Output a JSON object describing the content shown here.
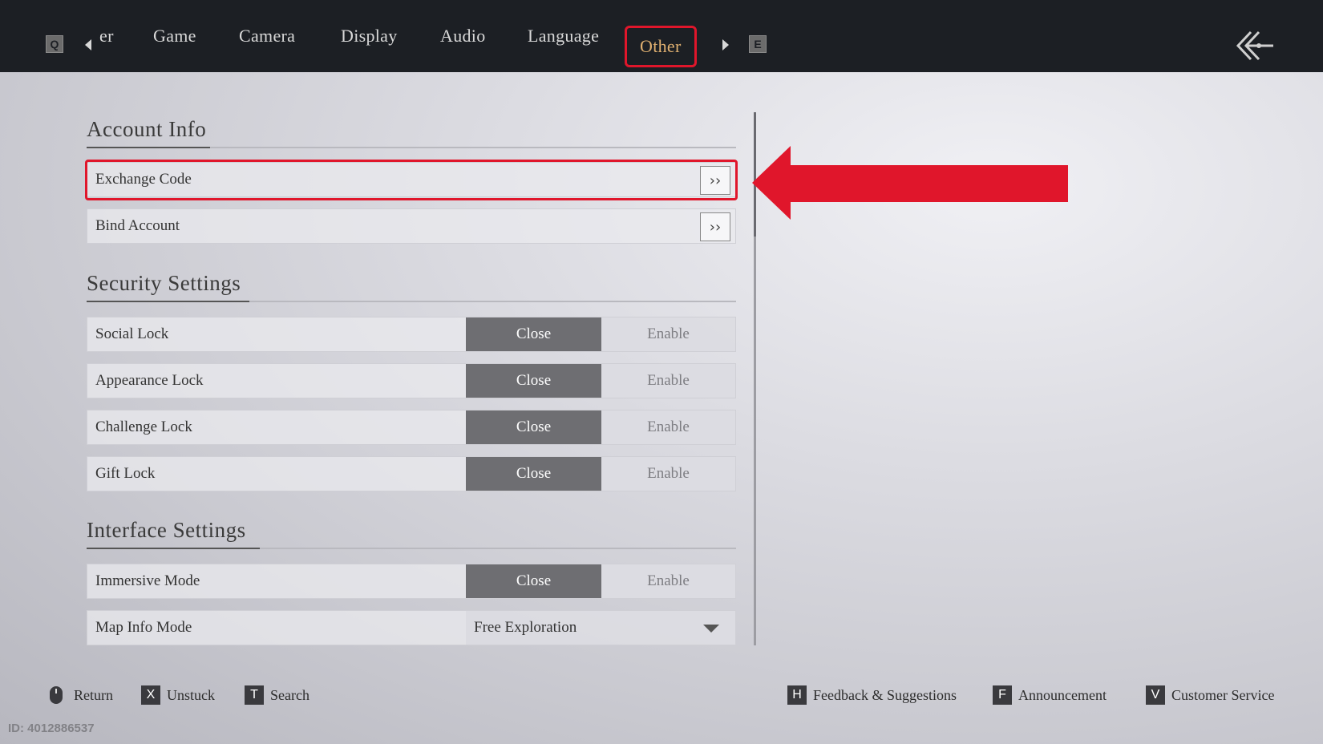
{
  "tabs": {
    "prev_key": "Q",
    "next_key": "E",
    "truncated_label": "er",
    "items": [
      "Game",
      "Camera",
      "Display",
      "Audio",
      "Language",
      "Other"
    ],
    "active": "Other"
  },
  "sections": {
    "account": {
      "title": "Account Info",
      "rows": [
        "Exchange Code",
        "Bind Account"
      ]
    },
    "security": {
      "title": "Security Settings",
      "rows": [
        "Social Lock",
        "Appearance Lock",
        "Challenge Lock",
        "Gift Lock"
      ]
    },
    "interface": {
      "title": "Interface Settings",
      "immersive": "Immersive Mode",
      "map_info": "Map Info Mode",
      "map_info_value": "Free Exploration"
    }
  },
  "toggle": {
    "close": "Close",
    "enable": "Enable",
    "selected": "Close"
  },
  "footer": {
    "return": {
      "key": "",
      "label": "Return"
    },
    "unstuck": {
      "key": "X",
      "label": "Unstuck"
    },
    "search": {
      "key": "T",
      "label": "Search"
    },
    "feedback": {
      "key": "H",
      "label": "Feedback & Suggestions"
    },
    "announcement": {
      "key": "F",
      "label": "Announcement"
    },
    "service": {
      "key": "V",
      "label": "Customer Service"
    }
  },
  "watermark": "ID: 4012886537",
  "colors": {
    "highlight": "#e0162b",
    "active_tab_text": "#e0b070",
    "topbar": "#1c1f24"
  },
  "icons": [
    "back-arrow-icon",
    "chevron-right-icon",
    "caret-down-icon",
    "mouse-icon",
    "red-arrow-annotation"
  ]
}
